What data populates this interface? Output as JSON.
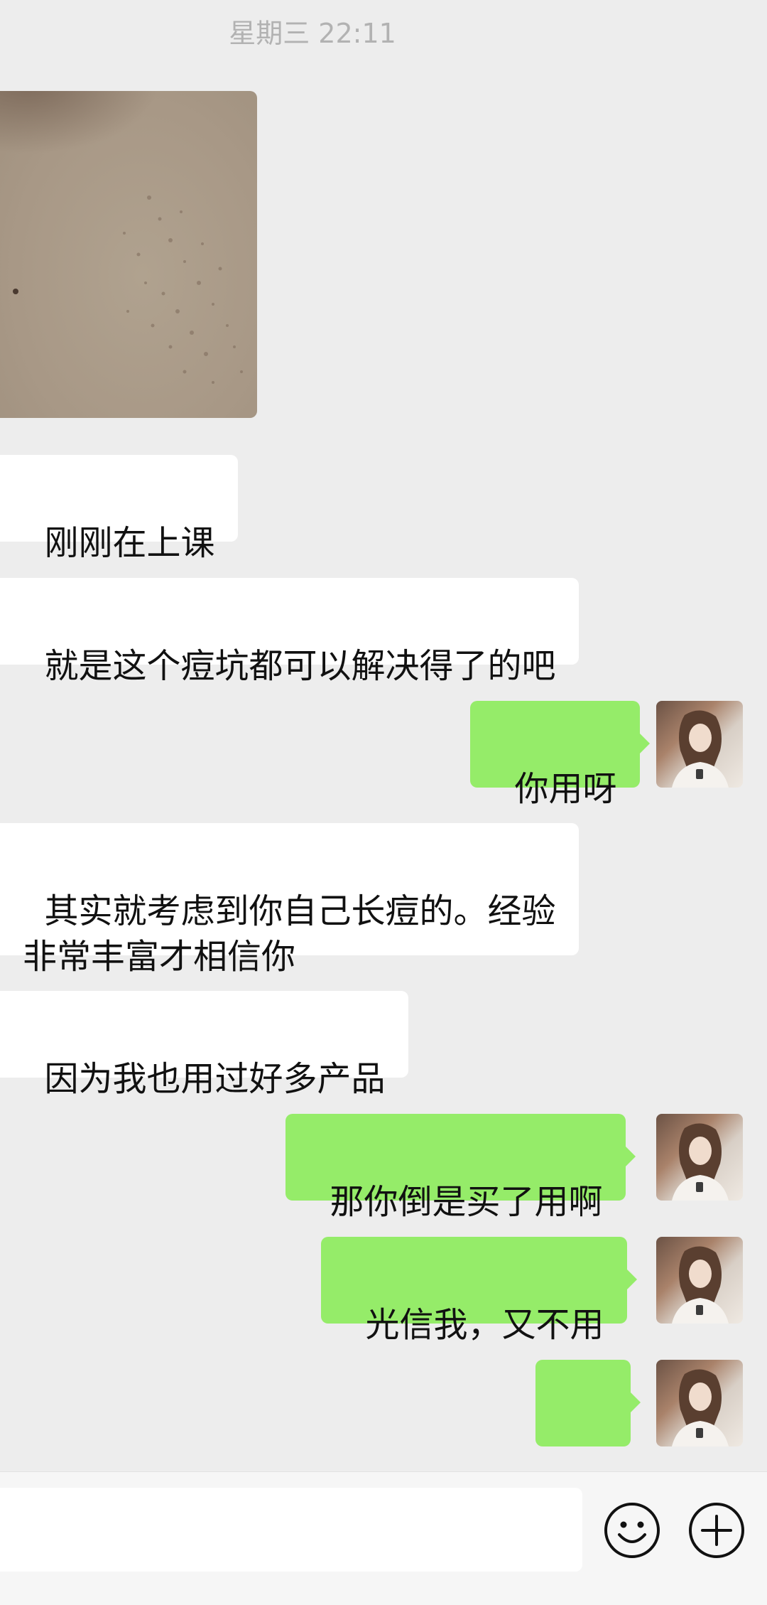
{
  "header": {
    "timestamp": "星期三 22:11"
  },
  "messages": [
    {
      "side": "left",
      "type": "image",
      "alt": ""
    },
    {
      "side": "left",
      "type": "text",
      "text": "刚刚在上课"
    },
    {
      "side": "left",
      "type": "text",
      "text": "就是这个痘坑都可以解决得了的吧"
    },
    {
      "side": "right",
      "type": "text",
      "text": "你用呀"
    },
    {
      "side": "left",
      "type": "text",
      "text": "其实就考虑到你自己长痘的。经验\n非常丰富才相信你"
    },
    {
      "side": "left",
      "type": "text",
      "text": "因为我也用过好多产品"
    },
    {
      "side": "right",
      "type": "text",
      "text": "那你倒是买了用啊"
    },
    {
      "side": "right",
      "type": "text",
      "text": "光信我，又不用"
    },
    {
      "side": "right",
      "type": "emoji",
      "text": "😂",
      "icon": "tears-of-joy-emoji"
    }
  ],
  "input": {
    "value": "",
    "emoji_icon": "emoji-icon",
    "add_icon": "plus-icon"
  },
  "colors": {
    "background": "#ededed",
    "incoming_bubble": "#ffffff",
    "outgoing_bubble": "#95ec69",
    "timestamp": "#b2b2b2"
  }
}
